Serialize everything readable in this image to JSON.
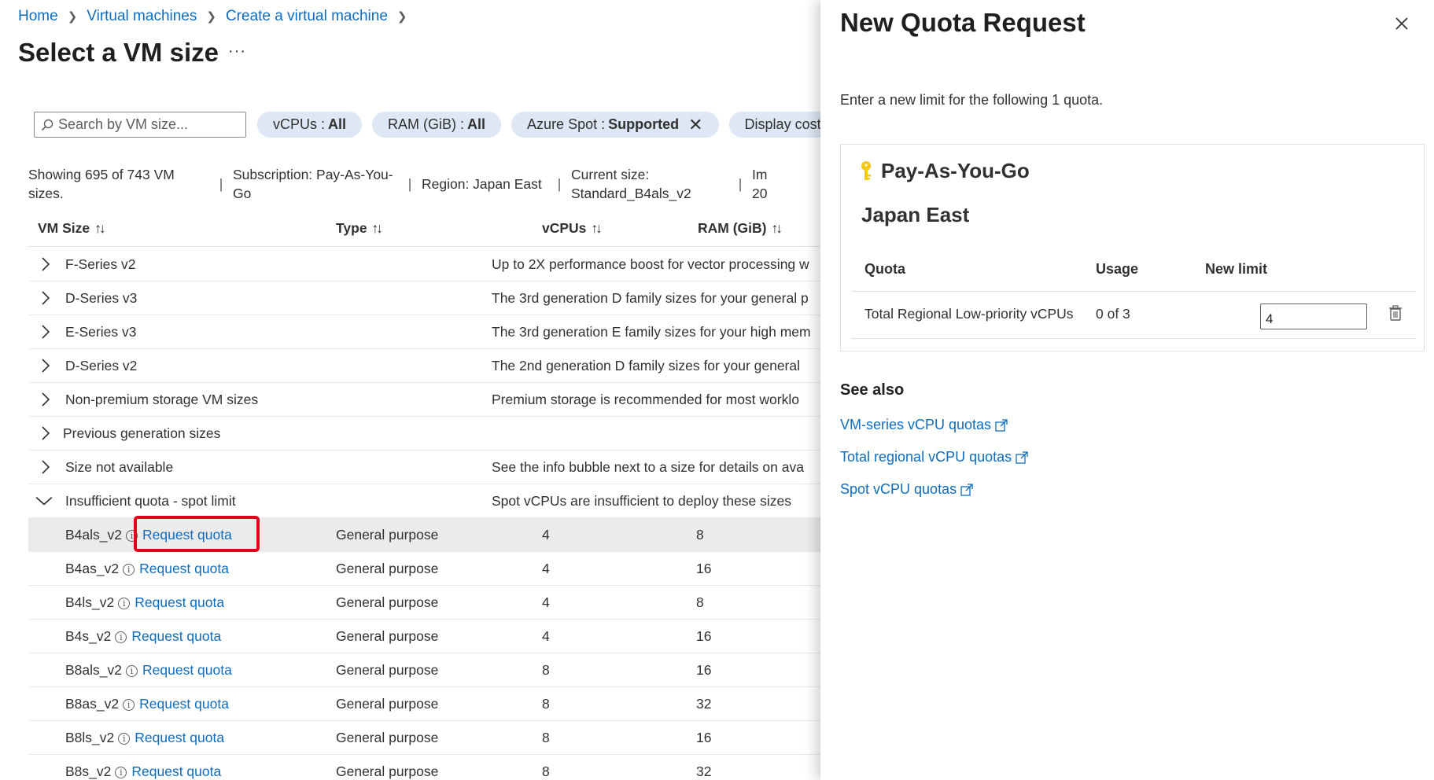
{
  "breadcrumb": {
    "items": [
      "Home",
      "Virtual machines",
      "Create a virtual machine"
    ]
  },
  "page": {
    "title": "Select a VM size",
    "more": "···"
  },
  "filters": {
    "search_placeholder": "Search by VM size...",
    "pills": [
      {
        "label": "vCPUs : ",
        "value": "All"
      },
      {
        "label": "RAM (GiB) : ",
        "value": "All"
      },
      {
        "label": "Azure Spot : ",
        "value": "Supported"
      },
      {
        "label": "Display cost : ",
        "value": ""
      }
    ]
  },
  "info": {
    "showing": "Showing 695 of 743 VM sizes.",
    "subscription": "Subscription: Pay-As-You-Go",
    "region": "Region: Japan East",
    "current_size": "Current size: Standard_B4als_v2",
    "extra": "Im 20"
  },
  "table": {
    "columns": [
      "VM Size",
      "Type",
      "vCPUs",
      "RAM (GiB)"
    ],
    "sort_icon": "↑↓",
    "groups": [
      {
        "name": "F-Series v2",
        "desc": "Up to 2X performance boost for vector processing w"
      },
      {
        "name": "D-Series v3",
        "desc": "The 3rd generation D family sizes for your general p"
      },
      {
        "name": "E-Series v3",
        "desc": "The 3rd generation E family sizes for your high mem"
      },
      {
        "name": "D-Series v2",
        "desc": "The 2nd generation D family sizes for your general"
      },
      {
        "name": "Non-premium storage VM sizes",
        "desc": "Premium storage is recommended for most worklo"
      },
      {
        "name": "Previous generation sizes",
        "desc": ""
      },
      {
        "name": "Size not available",
        "desc": "See the info bubble next to a size for details on ava"
      },
      {
        "name": "Insufficient quota - spot limit",
        "desc": "Spot vCPUs are insufficient to deploy these sizes"
      }
    ],
    "request_label": "Request quota",
    "info_glyph": "i",
    "sizes": [
      {
        "name": "B4als_v2",
        "type": "General purpose",
        "vcpus": "4",
        "ram": "8"
      },
      {
        "name": "B4as_v2",
        "type": "General purpose",
        "vcpus": "4",
        "ram": "16"
      },
      {
        "name": "B4ls_v2",
        "type": "General purpose",
        "vcpus": "4",
        "ram": "8"
      },
      {
        "name": "B4s_v2",
        "type": "General purpose",
        "vcpus": "4",
        "ram": "16"
      },
      {
        "name": "B8als_v2",
        "type": "General purpose",
        "vcpus": "8",
        "ram": "16"
      },
      {
        "name": "B8as_v2",
        "type": "General purpose",
        "vcpus": "8",
        "ram": "32"
      },
      {
        "name": "B8ls_v2",
        "type": "General purpose",
        "vcpus": "8",
        "ram": "16"
      },
      {
        "name": "B8s_v2",
        "type": "General purpose",
        "vcpus": "8",
        "ram": "32"
      }
    ]
  },
  "panel": {
    "title": "New Quota Request",
    "description": "Enter a new limit for the following 1 quota.",
    "subscription": "Pay-As-You-Go",
    "region": "Japan East",
    "headers": {
      "quota": "Quota",
      "usage": "Usage",
      "new_limit": "New limit"
    },
    "row": {
      "quota": "Total Regional Low-priority vCPUs",
      "usage": "0 of 3",
      "new_limit": "4"
    },
    "see_also": "See also",
    "links": [
      "VM-series vCPU quotas",
      "Total regional vCPU quotas",
      "Spot vCPU quotas"
    ]
  },
  "colors": {
    "accent": "#0f6cbd",
    "highlight": "#e3001b",
    "pill": "#dde7f5",
    "key": "#f2c811"
  }
}
